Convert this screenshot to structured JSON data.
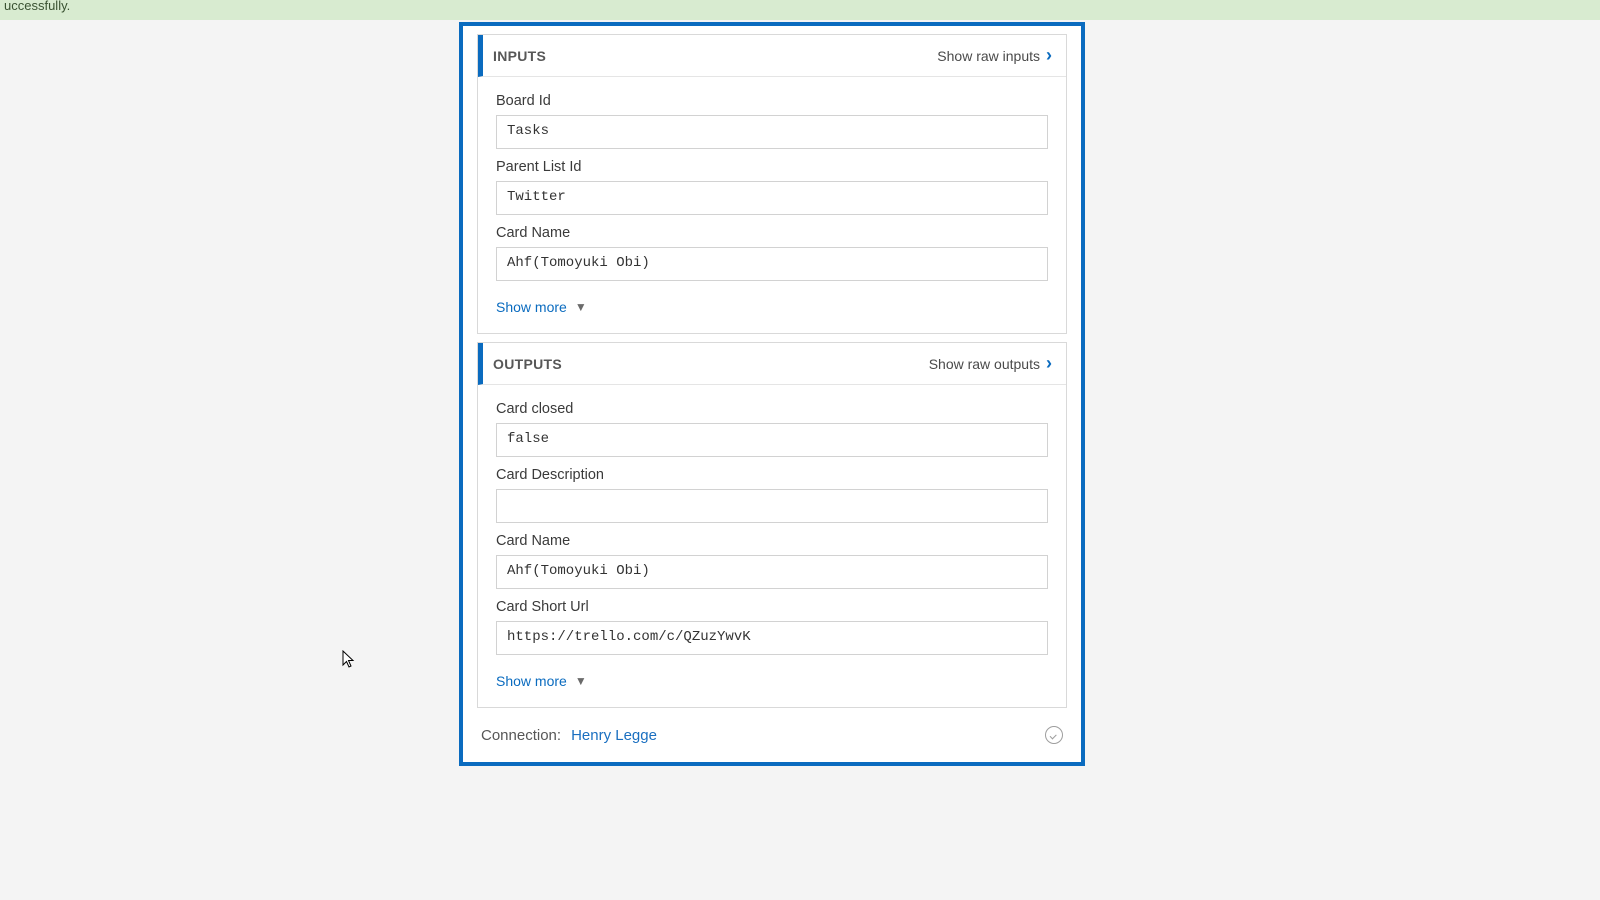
{
  "banner": {
    "text": "uccessfully."
  },
  "inputs": {
    "title": "INPUTS",
    "raw_link": "Show raw inputs",
    "fields": {
      "board_id": {
        "label": "Board Id",
        "value": "Tasks"
      },
      "parent_list_id": {
        "label": "Parent List Id",
        "value": "Twitter"
      },
      "card_name": {
        "label": "Card Name",
        "value": "Ahf(Tomoyuki Obi)"
      }
    },
    "show_more": "Show more"
  },
  "outputs": {
    "title": "OUTPUTS",
    "raw_link": "Show raw outputs",
    "fields": {
      "card_closed": {
        "label": "Card closed",
        "value": "false"
      },
      "card_description": {
        "label": "Card Description",
        "value": ""
      },
      "card_name": {
        "label": "Card Name",
        "value": "Ahf(Tomoyuki Obi)"
      },
      "card_short_url": {
        "label": "Card Short Url",
        "value": "https://trello.com/c/QZuzYwvK"
      }
    },
    "show_more": "Show more"
  },
  "connection": {
    "label": "Connection:",
    "name": "Henry Legge"
  }
}
